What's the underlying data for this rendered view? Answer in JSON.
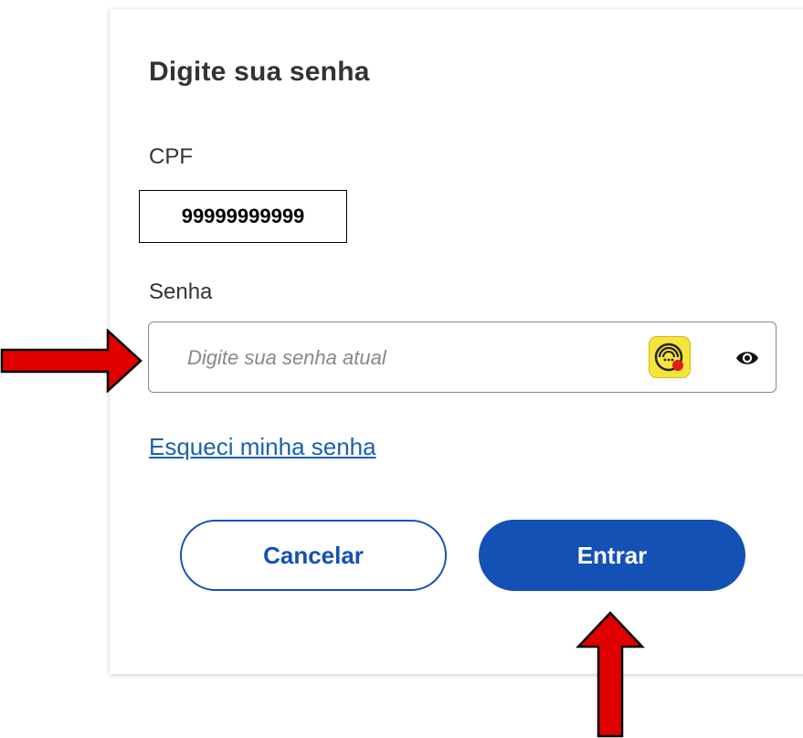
{
  "login": {
    "title": "Digite sua senha",
    "cpf_label": "CPF",
    "cpf_value": "99999999999",
    "password_label": "Senha",
    "password_placeholder": "Digite sua senha atual",
    "password_value": "",
    "forgot_link": "Esqueci minha senha",
    "cancel_label": "Cancelar",
    "enter_label": "Entrar"
  },
  "icons": {
    "extension": "password-manager-extension-icon",
    "toggle_visibility": "eye-icon"
  },
  "annotations": {
    "arrow_to_password": "red-arrow-right",
    "arrow_to_enter": "red-arrow-up"
  },
  "colors": {
    "primary": "#1351b4",
    "link": "#1a5fb4",
    "annotation_arrow": "#e00000",
    "extension_icon_bg": "#f5e43b"
  }
}
